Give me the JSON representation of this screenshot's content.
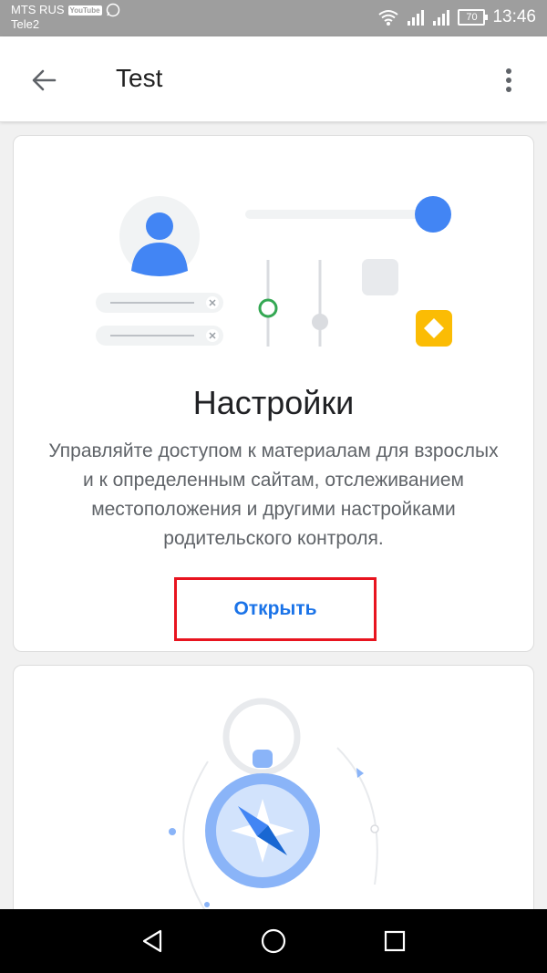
{
  "status_bar": {
    "carrier_primary": "MTS RUS",
    "carrier_badge": "YouTube",
    "carrier_secondary": "Tele2",
    "battery_level": "70",
    "time": "13:46",
    "icons": [
      "whatsapp-icon",
      "wifi-icon",
      "signal-icon",
      "signal-icon",
      "battery-icon"
    ]
  },
  "app_bar": {
    "title": "Test",
    "icons": [
      "back-arrow-icon",
      "more-vert-icon"
    ]
  },
  "settings_card": {
    "title": "Настройки",
    "description": "Управляйте доступом к материалам для взрослых и к определенным сайтам, отслеживанием местоположения и другими настройками родительского контроля.",
    "open_label": "Открыть",
    "highlight_color": "#e8141f",
    "accent_color": "#4285f4"
  },
  "second_card": {
    "illustration": "compass-icon"
  },
  "nav_bar": {
    "icons": [
      "back-triangle-icon",
      "home-circle-icon",
      "recents-square-icon"
    ]
  }
}
